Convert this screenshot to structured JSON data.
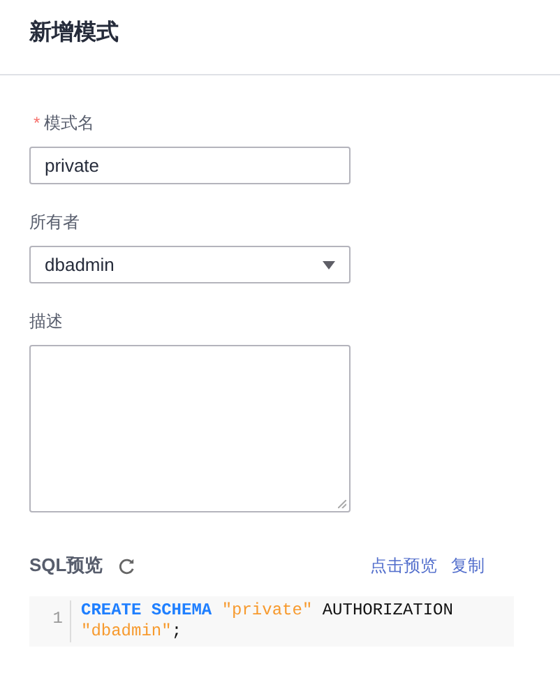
{
  "title": "新增模式",
  "fields": [
    {
      "kind": "input",
      "label": "模式名",
      "required_mark": "*",
      "value": "private"
    },
    {
      "kind": "select",
      "label": "所有者",
      "value": "dbadmin"
    },
    {
      "kind": "textarea",
      "label": "描述"
    }
  ],
  "sql_preview": {
    "title": "SQL预览",
    "links": [
      "点击预览",
      "复制"
    ],
    "lines": [
      {
        "number": "1",
        "tokens": [
          {
            "kind": "keyword",
            "text": "CREATE SCHEMA "
          },
          {
            "kind": "string",
            "text": "\"private\""
          },
          {
            "kind": "plain",
            "text": " AUTHORIZATION "
          },
          {
            "kind": "string",
            "text": "\"dbadmin\""
          },
          {
            "kind": "plain",
            "text": ";"
          }
        ]
      }
    ]
  }
}
